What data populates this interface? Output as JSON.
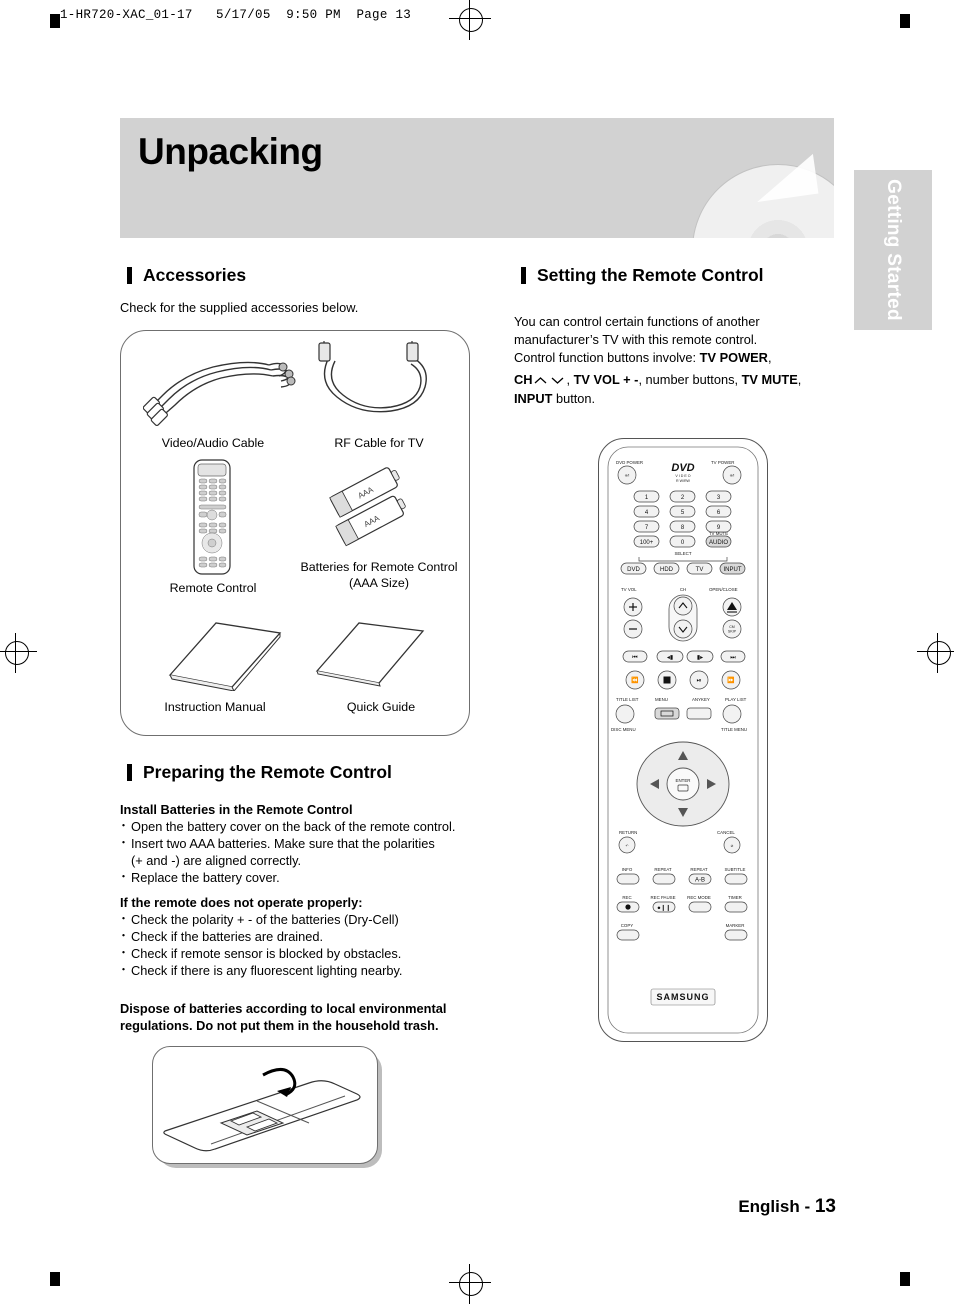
{
  "print_header": "1-HR720-XAC_01-17   5/17/05  9:50 PM  Page 13",
  "page_title": "Unpacking",
  "side_tab": "Getting Started",
  "left_column": {
    "accessories": {
      "heading": "Accessories",
      "intro": "Check for the supplied accessories below.",
      "items": [
        {
          "caption": "Video/Audio Cable"
        },
        {
          "caption": "RF Cable for TV"
        },
        {
          "caption": "Remote Control"
        },
        {
          "caption": "Batteries for Remote Control (AAA Size)"
        },
        {
          "caption": "Instruction Manual"
        },
        {
          "caption": "Quick Guide"
        }
      ]
    },
    "preparing": {
      "heading": "Preparing the Remote Control",
      "install_title": "Install Batteries in the Remote Control",
      "install_steps": [
        "Open the battery cover on the back of the remote control.",
        "Insert two AAA batteries. Make sure that the polarities",
        "(+ and -) are aligned correctly.",
        "Replace the battery cover."
      ],
      "trouble_title": "If the remote does not operate properly:",
      "trouble_steps": [
        "Check the polarity + - of the batteries (Dry-Cell)",
        "Check if the batteries are drained.",
        "Check if remote sensor is blocked by obstacles.",
        "Check if there is any fluorescent lighting nearby."
      ],
      "dispose_line1": "Dispose of batteries according to local environmental",
      "dispose_line2": "regulations. Do not put them in the household trash."
    }
  },
  "right_column": {
    "heading": "Setting the Remote Control",
    "para_line1": "You can control certain functions of another",
    "para_line2": "manufacturer’s TV with this remote control.",
    "para_line3_pre": "Control function buttons involve: ",
    "para_line3_bold": "TV POWER",
    "para_line3_post": ",",
    "para_line4_a": "CH",
    "para_line4_b": ", ",
    "para_line4_c": "TV VOL + -",
    "para_line4_d": ", number buttons, ",
    "para_line4_e": "TV MUTE",
    "para_line4_f": ",",
    "para_line5_a": "INPUT",
    "para_line5_b": " button."
  },
  "remote": {
    "brand": "SAMSUNG",
    "logo": "DVD",
    "logo_sub1": "V I D E O",
    "logo_sub2": "RW/RW",
    "labels": {
      "dvd_power": "DVD POWER",
      "tv_power": "TV POWER",
      "select": "SELECT",
      "tv_vol": "TV VOL",
      "ch": "CH",
      "open_close": "OPEN/CLOSE",
      "tv_mute": "TV MUTE",
      "audio": "AUDIO",
      "cm_skip": "CM SKIP",
      "title_list": "TITLE LIST",
      "menu": "MENU",
      "anykey": "ANYKEY",
      "play_list": "PLAY LIST",
      "disc_menu": "DISC MENU",
      "title_menu": "TITLE MENU",
      "enter": "ENTER",
      "return": "RETURN",
      "cancel": "CANCEL",
      "info": "INFO",
      "repeat": "REPEAT",
      "repeat_ab": "REPEAT",
      "repeat_ab_sub": "A-B",
      "subtitle": "SUBTITLE",
      "rec": "REC",
      "rec_pause": "REC PAUSE",
      "rec_mode": "REC MODE",
      "timer": "TIMER",
      "copy": "COPY",
      "marker": "MARKER"
    },
    "numbers": [
      "1",
      "2",
      "3",
      "4",
      "5",
      "6",
      "7",
      "8",
      "9",
      "100+",
      "0"
    ],
    "source_buttons": [
      "DVD",
      "HDD",
      "TV",
      "INPUT"
    ]
  },
  "footer": {
    "language": "English",
    "dash": "-",
    "page": "13"
  }
}
